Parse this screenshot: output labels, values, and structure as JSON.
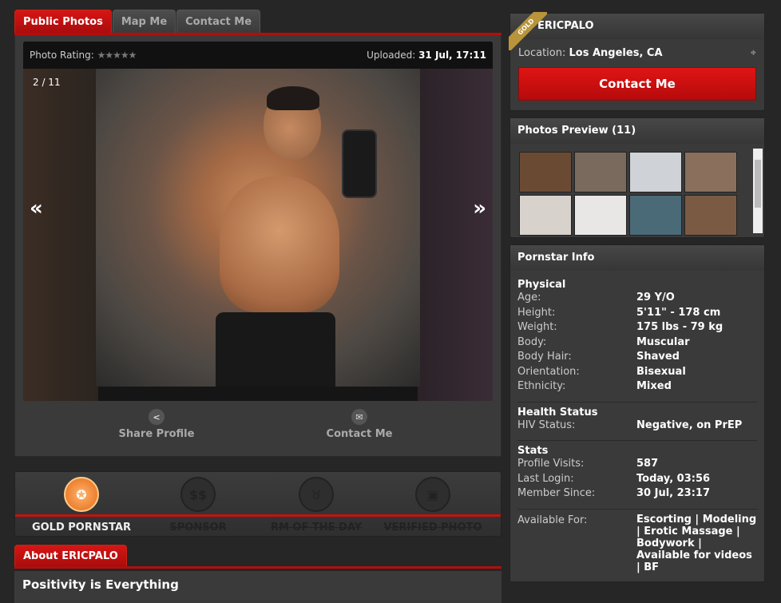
{
  "tabs": [
    "Public Photos",
    "Map Me",
    "Contact Me"
  ],
  "photo": {
    "rating_label": "Photo Rating:",
    "stars": "★★★★★",
    "uploaded_label": "Uploaded:",
    "uploaded_value": "31 Jul, 17:11",
    "counter": "2 / 11",
    "prev": "«",
    "next": "»"
  },
  "actions": {
    "share": "Share Profile",
    "contact": "Contact Me"
  },
  "badges": [
    {
      "label": "GOLD PORNSTAR",
      "active": true
    },
    {
      "label": "SPONSOR",
      "active": false
    },
    {
      "label": "RM OF THE DAY",
      "active": false
    },
    {
      "label": "VERIFIED PHOTO",
      "active": false
    }
  ],
  "about": {
    "tab": "About ERICPALO",
    "headline": "Positivity is Everything"
  },
  "profile": {
    "ribbon": "GOLD",
    "name": "ERICPALO",
    "location_label": "Location:",
    "location": "Los Angeles, CA",
    "contact_button": "Contact Me"
  },
  "photos_preview": {
    "title": "Photos Preview (11)",
    "thumb_colors": [
      "#6b4a34",
      "#7a6a5e",
      "#cfd3d8",
      "#8a6f5d",
      "#d8d2cc",
      "#e9e7e6",
      "#4a6a78",
      "#7b5a44"
    ]
  },
  "info": {
    "title": "Pornstar Info",
    "physical_title": "Physical",
    "physical": [
      [
        "Age:",
        "29 Y/O"
      ],
      [
        "Height:",
        "5'11\" - 178 cm"
      ],
      [
        "Weight:",
        "175 lbs - 79 kg"
      ],
      [
        "Body:",
        "Muscular"
      ],
      [
        "Body Hair:",
        "Shaved"
      ],
      [
        "Orientation:",
        "Bisexual"
      ],
      [
        "Ethnicity:",
        "Mixed"
      ]
    ],
    "health_title": "Health Status",
    "health": [
      [
        "HIV Status:",
        "Negative, on PrEP"
      ]
    ],
    "stats_title": "Stats",
    "stats": [
      [
        "Profile Visits:",
        "587"
      ],
      [
        "Last Login:",
        "Today, 03:56"
      ],
      [
        "Member Since:",
        "30 Jul, 23:17"
      ]
    ],
    "available_label": "Available For:",
    "available_value": "Escorting | Modeling | Erotic Massage | Bodywork | Available for videos | BF"
  }
}
